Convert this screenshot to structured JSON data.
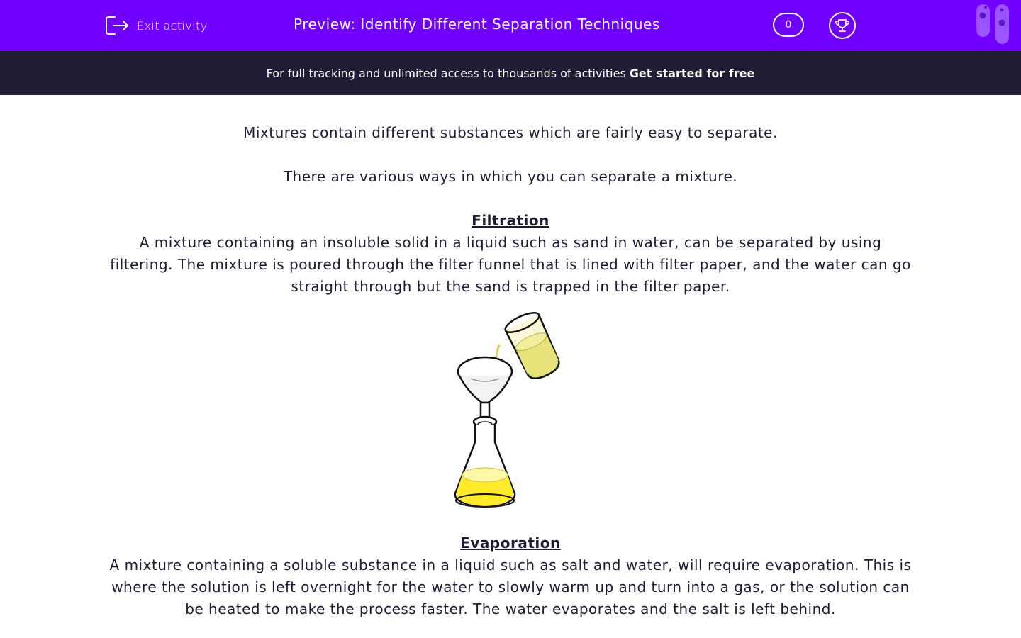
{
  "header": {
    "exit_label": "Exit activity",
    "title": "Preview: Identify Different Separation Techniques",
    "score": "0",
    "accent_color": "#7000ff"
  },
  "banner": {
    "text": "For full tracking and unlimited access to thousands of activities",
    "cta": "Get started for free"
  },
  "content": {
    "intro1": "Mixtures contain different substances which are fairly easy to separate.",
    "intro2": "There are various ways in which you can separate a mixture.",
    "sections": [
      {
        "heading": "Filtration",
        "body": "A mixture containing an insoluble solid in a liquid such as sand in water, can be separated by using filtering. The mixture is poured through the filter funnel that is lined with filter paper, and the water can go straight through but the sand is trapped in the filter paper."
      },
      {
        "heading": "Evaporation",
        "body": "A mixture containing a soluble substance in a liquid such as salt and water, will require evaporation. This is where the solution is left overnight for the water to slowly warm up and turn into a gas, or the solution can be heated to make the process faster. The water evaporates and the salt is left behind."
      }
    ]
  },
  "icons": {
    "exit": "exit-door-icon",
    "trophy": "trophy-icon",
    "logo": "test-tubes-logo",
    "illustration": "filtration-apparatus"
  }
}
